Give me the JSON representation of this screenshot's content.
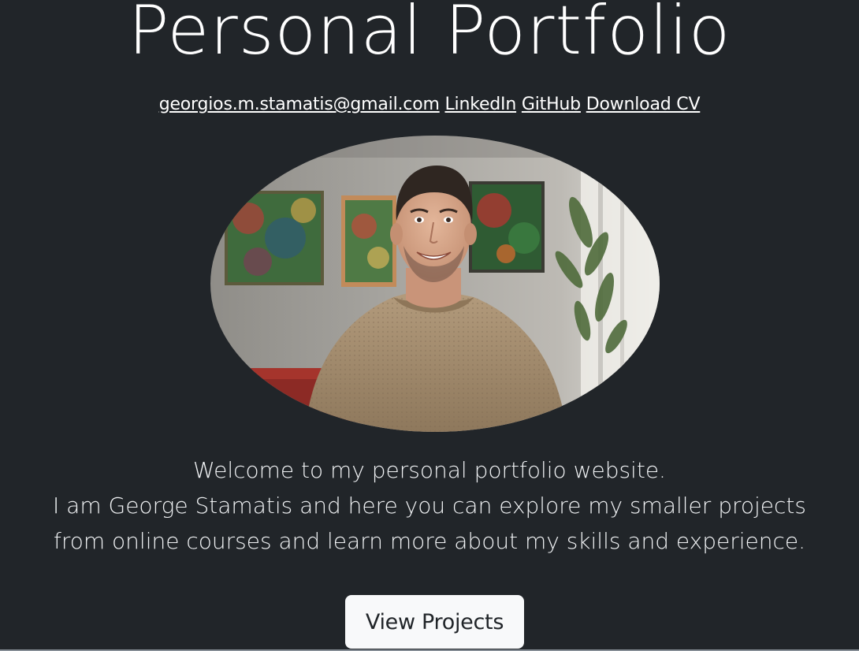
{
  "hero": {
    "title": "Personal Portfolio",
    "links": {
      "email": "georgios.m.stamatis@gmail.com",
      "linkedin": "LinkedIn",
      "github": "GitHub",
      "cv": "Download CV"
    },
    "portrait_alt": "George Stamatis",
    "intro": [
      "Welcome to my personal portfolio website.",
      "I am George Stamatis and here you can explore my smaller projects",
      "from online courses and learn more about my skills and experience."
    ],
    "cta_label": "View Projects"
  },
  "colors": {
    "background": "#212529",
    "text": "#ffffff",
    "button_bg": "#f8f9fa",
    "button_text": "#212529"
  }
}
